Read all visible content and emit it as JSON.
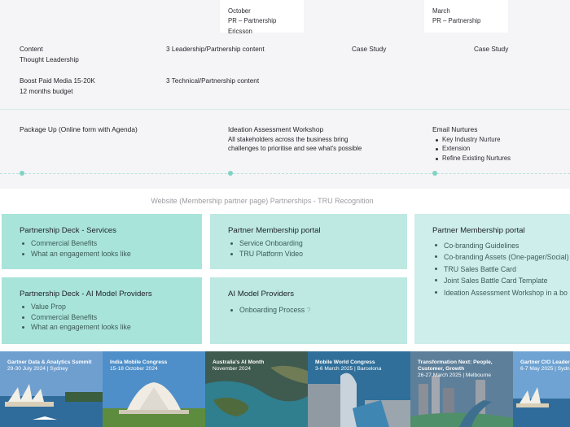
{
  "top_cards": [
    {
      "month": "October",
      "label": "PR – Partnership Ericsson"
    },
    {
      "month": "March",
      "label": "PR – Partnership"
    }
  ],
  "content_rows": {
    "content_label": "Content",
    "thought_leadership": "Thought Leadership",
    "leadership_content": "3 Leadership/Partnership content",
    "case_study_1": "Case Study",
    "case_study_2": "Case Study",
    "boost_paid": "Boost Paid Media 15-20K",
    "budget": "12 months budget",
    "technical_content": "3 Technical/Partnership content"
  },
  "timeline": {
    "col1_title": "Package Up (Online form with Agenda)",
    "col2_title": "Ideation Assessment Workshop",
    "col2_desc": "All stakeholders across the business bring challenges to prioritise and see what's possible",
    "col3_title": "Email Nurtures",
    "col3_items": [
      "Key Industry Nurture",
      "Extension",
      "Refine Existing Nurtures"
    ]
  },
  "section_label": "Website (Membership partner page) Partnerships - TRU Recognition",
  "tiles": {
    "deck_services": {
      "title": "Partnership Deck - Services",
      "items": [
        "Commercial Benefits",
        "What an engagement looks like"
      ]
    },
    "deck_ai": {
      "title": "Partnership Deck - AI Model Providers",
      "items": [
        "Value Prop",
        "Commercial Benefits",
        "What an engagement looks like"
      ]
    },
    "portal_1": {
      "title": "Partner Membership portal",
      "items": [
        "Service Onboarding",
        "TRU Platform Video"
      ]
    },
    "ai_providers": {
      "title": "AI Model Providers",
      "items": [
        "Onboarding Process"
      ],
      "qmark": "?"
    },
    "portal_2": {
      "title": "Partner Membership portal",
      "items": [
        "Co-branding Guidelines",
        "Co-branding Assets (One-pager/Social)",
        "TRU Sales Battle Card",
        "Joint Sales Battle Card Template",
        "Ideation Assessment Workshop in a bo"
      ]
    }
  },
  "events": [
    {
      "name": "Gartner Data & Analytics Summit",
      "date": "29-30 July 2024 | Sydney",
      "icon": "opera-house"
    },
    {
      "name": "India Mobile Congress",
      "date": "15-18 October 2024",
      "icon": "lotus-temple"
    },
    {
      "name": "Australia's AI Month",
      "date": "November 2024",
      "icon": "coastline"
    },
    {
      "name": "Mobile World Congress",
      "date": "3-6 March 2025 | Barcelona",
      "icon": "harbour-city"
    },
    {
      "name": "Transformation Next: People, Customer, Growth",
      "date": "26-27 March 2025 | Melbourne",
      "icon": "river-city"
    },
    {
      "name": "Gartner CIO Leader",
      "date": "6-7 May 2025 | Sydn",
      "icon": "opera-house"
    }
  ]
}
